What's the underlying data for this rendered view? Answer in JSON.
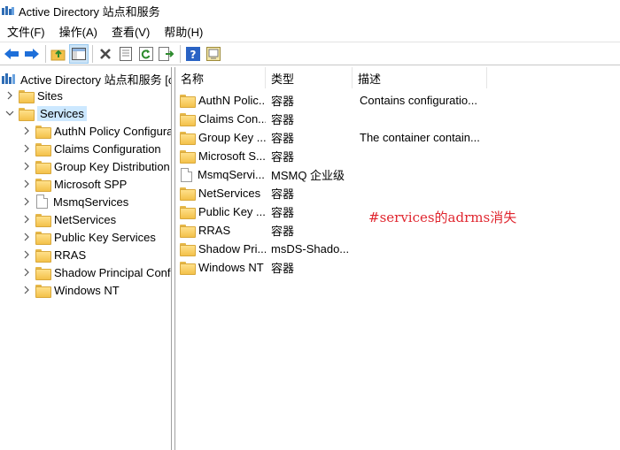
{
  "window": {
    "title": "Active Directory 站点和服务"
  },
  "menu": [
    "文件(F)",
    "操作(A)",
    "查看(V)",
    "帮助(H)"
  ],
  "toolbar": {
    "icons": [
      "back-arrow-icon",
      "forward-arrow-icon",
      "up-folder-icon",
      "show-hide-tree-icon",
      "delete-icon",
      "properties-icon",
      "refresh-icon",
      "export-list-icon",
      "help-icon",
      "console-icon"
    ],
    "colors": {
      "arrow": "#1e6fd9",
      "delete": "#4a4a4a",
      "help": "#2a63c4"
    }
  },
  "tree": {
    "root": "Active Directory 站点和服务 [c",
    "sites": "Sites",
    "services": "Services",
    "children": [
      "AuthN Policy Configura",
      "Claims Configuration",
      "Group Key Distribution",
      "Microsoft SPP",
      "MsmqServices",
      "NetServices",
      "Public Key Services",
      "RRAS",
      "Shadow Principal Conf",
      "Windows NT"
    ]
  },
  "list": {
    "columns": [
      "名称",
      "类型",
      "描述"
    ],
    "rows": [
      {
        "name": "AuthN Polic...",
        "type": "容器",
        "desc": "Contains configuratio...",
        "icon": "folder"
      },
      {
        "name": "Claims Con...",
        "type": "容器",
        "desc": "",
        "icon": "folder"
      },
      {
        "name": "Group Key ...",
        "type": "容器",
        "desc": "The container contain...",
        "icon": "folder"
      },
      {
        "name": "Microsoft S...",
        "type": "容器",
        "desc": "",
        "icon": "folder"
      },
      {
        "name": "MsmqServi...",
        "type": "MSMQ 企业级",
        "desc": "",
        "icon": "document"
      },
      {
        "name": "NetServices",
        "type": "容器",
        "desc": "",
        "icon": "folder"
      },
      {
        "name": "Public Key ...",
        "type": "容器",
        "desc": "",
        "icon": "folder"
      },
      {
        "name": "RRAS",
        "type": "容器",
        "desc": "",
        "icon": "folder"
      },
      {
        "name": "Shadow Pri...",
        "type": "msDS-Shado...",
        "desc": "",
        "icon": "folder"
      },
      {
        "name": "Windows NT",
        "type": "容器",
        "desc": "",
        "icon": "folder"
      }
    ]
  },
  "annotation": {
    "text": "#services的adrms消失",
    "color": "#e0262f"
  },
  "selection_color": "#cce8ff"
}
